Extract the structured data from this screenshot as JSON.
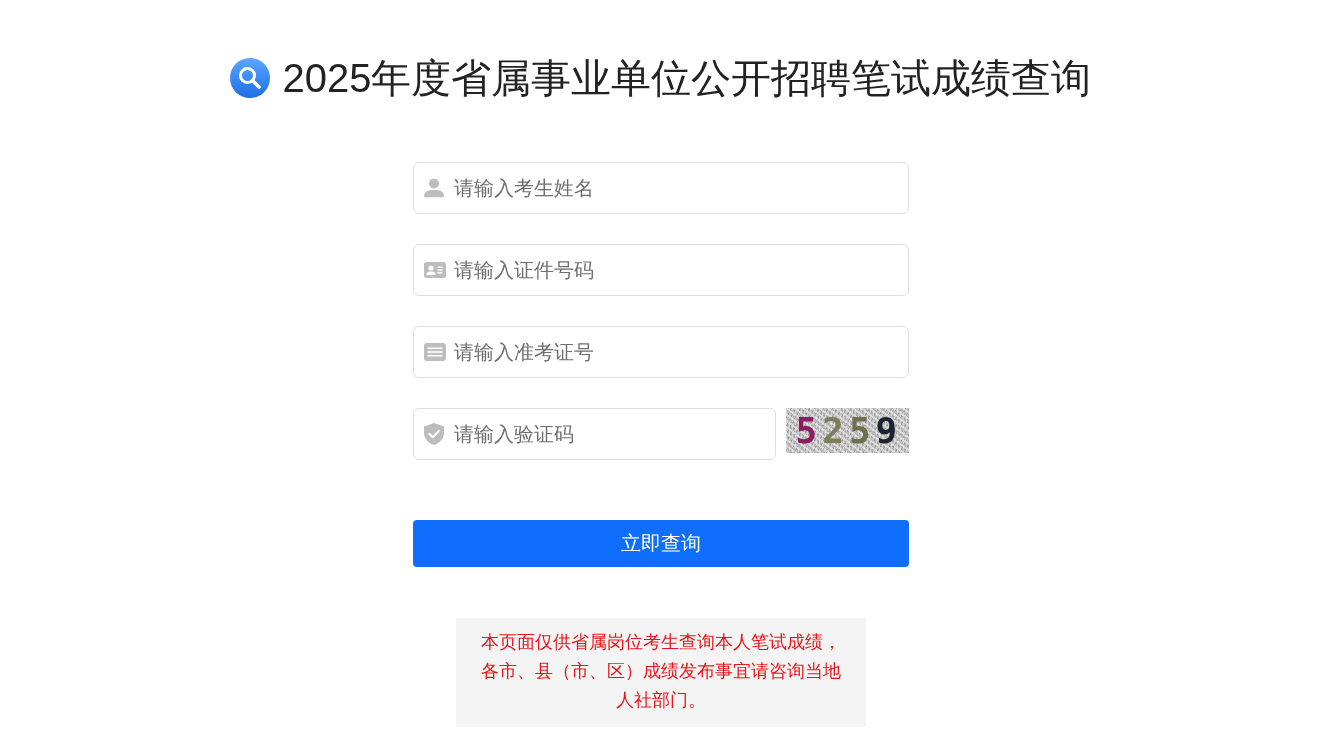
{
  "header": {
    "title": "2025年度省属事业单位公开招聘笔试成绩查询"
  },
  "form": {
    "fields": [
      {
        "kind": "name",
        "placeholder": "请输入考生姓名"
      },
      {
        "kind": "idcard",
        "placeholder": "请输入证件号码"
      },
      {
        "kind": "ticket",
        "placeholder": "请输入准考证号"
      },
      {
        "kind": "code",
        "placeholder": "请输入验证码",
        "captcha": "5259"
      }
    ],
    "submit": {
      "label": "立即查询"
    }
  },
  "notice": {
    "text": "本页面仅供省属岗位考生查询本人笔试成绩，各市、县（市、区）成绩发布事宜请咨询当地人社部门。"
  }
}
